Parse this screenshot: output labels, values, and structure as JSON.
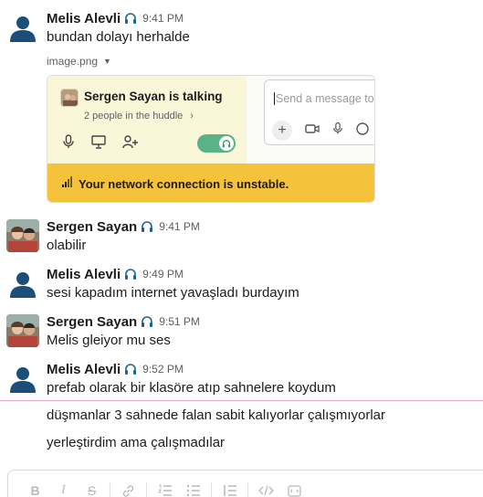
{
  "messages": [
    {
      "author": "Melis Alevli",
      "time": "9:41 PM",
      "text": "bundan dolayı herhalde",
      "avatar": "default-avatar-icon"
    },
    {
      "author": "Sergen Sayan",
      "time": "9:41 PM",
      "text": "olabilir",
      "avatar": "photo"
    },
    {
      "author": "Melis Alevli",
      "time": "9:49 PM",
      "text": "sesi kapadım internet yavaşladı burdayım",
      "avatar": "default-avatar-icon"
    },
    {
      "author": "Sergen Sayan",
      "time": "9:51 PM",
      "text": "Melis gleiyor mu ses",
      "avatar": "photo"
    },
    {
      "author": "Melis Alevli",
      "time": "9:52 PM",
      "text": "prefab olarak bir klasöre atıp sahnelere koydum",
      "avatar": "default-avatar-icon"
    }
  ],
  "continuation": [
    "düşmanlar 3 sahnede falan sabit kalıyorlar çalışmıyorlar",
    "yerleştirdim ama çalışmadılar"
  ],
  "attachment": {
    "filename": "image.png",
    "huddle_title": "Sergen Sayan is talking",
    "huddle_subtitle": "2 people in the huddle",
    "chevron": "›",
    "composer_placeholder": "Send a message to",
    "warning_text": "Your network connection is unstable."
  },
  "colors": {
    "huddle_bg": "#f9f7d8",
    "toggle_on": "#5ab287",
    "warning_bg": "#f4c33b",
    "new_divider": "#e6a8b8",
    "default_avatar": "#1b4f7a"
  },
  "toolbar_icons": [
    "bold-icon",
    "italic-icon",
    "strikethrough-icon",
    "link-icon",
    "ordered-list-icon",
    "bulleted-list-icon",
    "blockquote-icon",
    "code-icon",
    "code-block-icon"
  ],
  "toolbar_glyphs": {
    "bold": "B",
    "italic": "I",
    "strike": "S"
  }
}
